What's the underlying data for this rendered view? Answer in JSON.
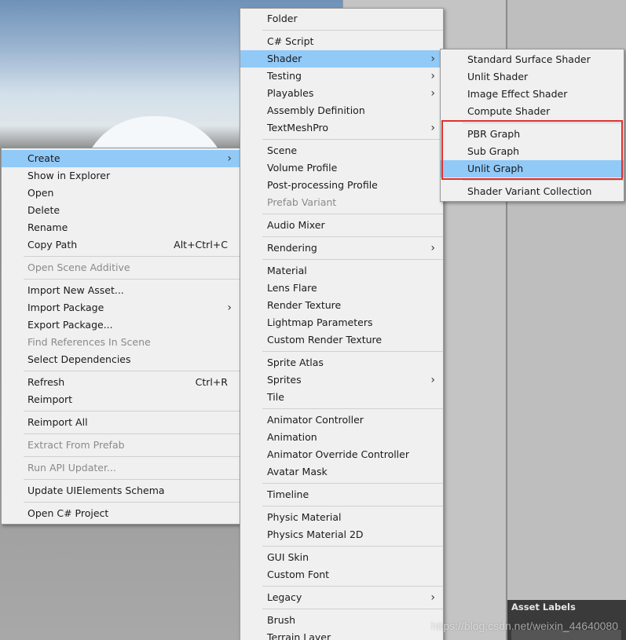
{
  "context_menu": {
    "items": [
      {
        "type": "item",
        "label": "Create",
        "submenu": true,
        "highlighted": true
      },
      {
        "type": "item",
        "label": "Show in Explorer"
      },
      {
        "type": "item",
        "label": "Open"
      },
      {
        "type": "item",
        "label": "Delete"
      },
      {
        "type": "item",
        "label": "Rename"
      },
      {
        "type": "item",
        "label": "Copy Path",
        "shortcut": "Alt+Ctrl+C"
      },
      {
        "type": "separator"
      },
      {
        "type": "item",
        "label": "Open Scene Additive",
        "disabled": true
      },
      {
        "type": "separator"
      },
      {
        "type": "item",
        "label": "Import New Asset..."
      },
      {
        "type": "item",
        "label": "Import Package",
        "submenu": true
      },
      {
        "type": "item",
        "label": "Export Package..."
      },
      {
        "type": "item",
        "label": "Find References In Scene",
        "disabled": true
      },
      {
        "type": "item",
        "label": "Select Dependencies"
      },
      {
        "type": "separator"
      },
      {
        "type": "item",
        "label": "Refresh",
        "shortcut": "Ctrl+R"
      },
      {
        "type": "item",
        "label": "Reimport"
      },
      {
        "type": "separator"
      },
      {
        "type": "item",
        "label": "Reimport All"
      },
      {
        "type": "separator"
      },
      {
        "type": "item",
        "label": "Extract From Prefab",
        "disabled": true
      },
      {
        "type": "separator"
      },
      {
        "type": "item",
        "label": "Run API Updater...",
        "disabled": true
      },
      {
        "type": "separator"
      },
      {
        "type": "item",
        "label": "Update UIElements Schema"
      },
      {
        "type": "separator"
      },
      {
        "type": "item",
        "label": "Open C# Project"
      }
    ]
  },
  "create_menu": {
    "items": [
      {
        "type": "item",
        "label": "Folder"
      },
      {
        "type": "separator"
      },
      {
        "type": "item",
        "label": "C# Script"
      },
      {
        "type": "item",
        "label": "Shader",
        "submenu": true,
        "highlighted": true
      },
      {
        "type": "item",
        "label": "Testing",
        "submenu": true
      },
      {
        "type": "item",
        "label": "Playables",
        "submenu": true
      },
      {
        "type": "item",
        "label": "Assembly Definition"
      },
      {
        "type": "item",
        "label": "TextMeshPro",
        "submenu": true
      },
      {
        "type": "separator"
      },
      {
        "type": "item",
        "label": "Scene"
      },
      {
        "type": "item",
        "label": "Volume Profile"
      },
      {
        "type": "item",
        "label": "Post-processing Profile"
      },
      {
        "type": "item",
        "label": "Prefab Variant",
        "disabled": true
      },
      {
        "type": "separator"
      },
      {
        "type": "item",
        "label": "Audio Mixer"
      },
      {
        "type": "separator"
      },
      {
        "type": "item",
        "label": "Rendering",
        "submenu": true
      },
      {
        "type": "separator"
      },
      {
        "type": "item",
        "label": "Material"
      },
      {
        "type": "item",
        "label": "Lens Flare"
      },
      {
        "type": "item",
        "label": "Render Texture"
      },
      {
        "type": "item",
        "label": "Lightmap Parameters"
      },
      {
        "type": "item",
        "label": "Custom Render Texture"
      },
      {
        "type": "separator"
      },
      {
        "type": "item",
        "label": "Sprite Atlas"
      },
      {
        "type": "item",
        "label": "Sprites",
        "submenu": true
      },
      {
        "type": "item",
        "label": "Tile"
      },
      {
        "type": "separator"
      },
      {
        "type": "item",
        "label": "Animator Controller"
      },
      {
        "type": "item",
        "label": "Animation"
      },
      {
        "type": "item",
        "label": "Animator Override Controller"
      },
      {
        "type": "item",
        "label": "Avatar Mask"
      },
      {
        "type": "separator"
      },
      {
        "type": "item",
        "label": "Timeline"
      },
      {
        "type": "separator"
      },
      {
        "type": "item",
        "label": "Physic Material"
      },
      {
        "type": "item",
        "label": "Physics Material 2D"
      },
      {
        "type": "separator"
      },
      {
        "type": "item",
        "label": "GUI Skin"
      },
      {
        "type": "item",
        "label": "Custom Font"
      },
      {
        "type": "separator"
      },
      {
        "type": "item",
        "label": "Legacy",
        "submenu": true
      },
      {
        "type": "separator"
      },
      {
        "type": "item",
        "label": "Brush"
      },
      {
        "type": "item",
        "label": "Terrain Layer"
      }
    ]
  },
  "shader_menu": {
    "items": [
      {
        "type": "item",
        "label": "Standard Surface Shader"
      },
      {
        "type": "item",
        "label": "Unlit Shader"
      },
      {
        "type": "item",
        "label": "Image Effect Shader"
      },
      {
        "type": "item",
        "label": "Compute Shader"
      },
      {
        "type": "separator"
      },
      {
        "type": "item",
        "label": "PBR Graph"
      },
      {
        "type": "item",
        "label": "Sub Graph"
      },
      {
        "type": "item",
        "label": "Unlit Graph",
        "highlighted": true
      },
      {
        "type": "separator"
      },
      {
        "type": "item",
        "label": "Shader Variant Collection"
      }
    ]
  },
  "panel": {
    "asset_labels_title": "Asset Labels"
  },
  "watermark": "https://blog.csdn.net/weixin_44640080",
  "colors": {
    "highlight": "#91c9f7",
    "menu_background": "#f0f0f0",
    "annotation_box": "#e2302d",
    "disabled_text": "#8a8a8a"
  },
  "icons": {
    "submenu_arrow": "chevron-right-icon"
  }
}
